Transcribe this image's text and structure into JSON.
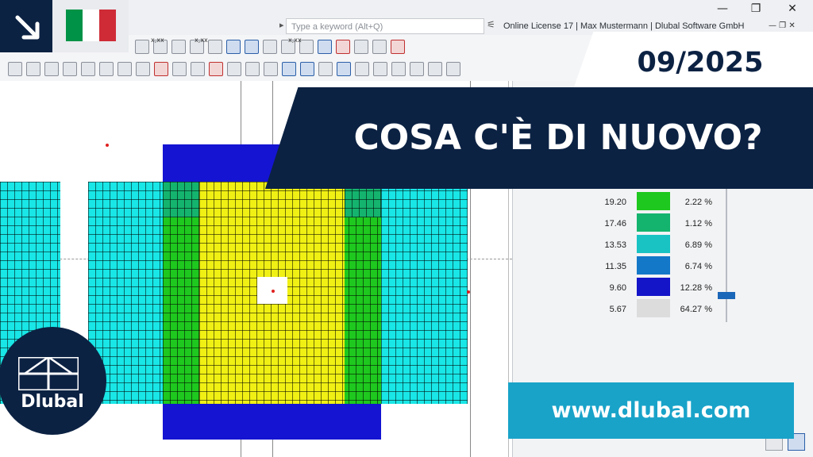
{
  "titlebar": {
    "search_placeholder": "Type a keyword (Alt+Q)",
    "license_text": "Online License 17 | Max Mustermann | Dlubal Software GmbH",
    "minimize": "—",
    "restore": "❐",
    "close": "✕"
  },
  "toolbar_labels": [
    "x,xx",
    "x,xx",
    "x,xx"
  ],
  "legend": {
    "items": [
      {
        "value": "19.20",
        "percent": "2.22 %",
        "color": "#1ec81e"
      },
      {
        "value": "17.46",
        "percent": "1.12 %",
        "color": "#14b46e"
      },
      {
        "value": "13.53",
        "percent": "6.89 %",
        "color": "#19c3c3"
      },
      {
        "value": "11.35",
        "percent": "6.74 %",
        "color": "#1478c8"
      },
      {
        "value": "9.60",
        "percent": "12.28 %",
        "color": "#1414c8"
      },
      {
        "value": "5.67",
        "percent": "64.27 %",
        "color": "#dcdcdc"
      }
    ]
  },
  "overlay": {
    "date": "09/2025",
    "headline": "COSA C'È DI NUOVO?",
    "url": "www.dlubal.com",
    "brand": "Dlubal",
    "flag_colors": [
      "#009246",
      "#ffffff",
      "#ce2b37"
    ],
    "navy": "#0c2243",
    "accent": "#19a3c9"
  },
  "mesh_colors": {
    "cyan": "#19e6e6",
    "green": "#1ec81e",
    "teal": "#14b46e",
    "yellow": "#f0f014",
    "blue": "#1414d2"
  }
}
